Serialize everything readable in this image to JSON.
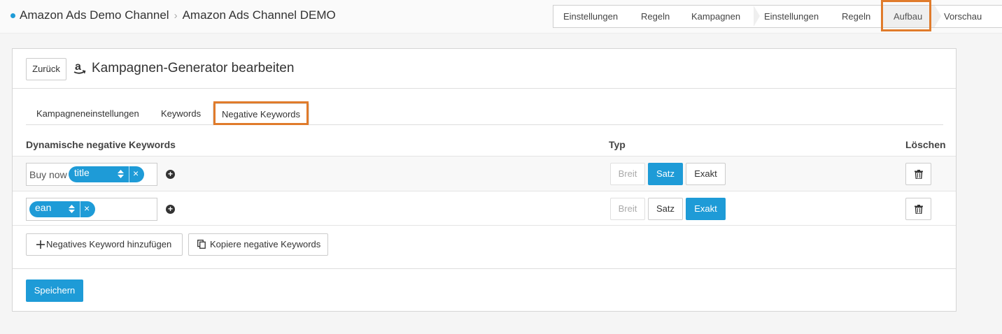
{
  "breadcrumb": {
    "channel": "Amazon Ads Demo Channel",
    "current": "Amazon Ads Channel DEMO"
  },
  "steps": [
    "Einstellungen",
    "Regeln",
    "Kampagnen",
    "Einstellungen",
    "Regeln",
    "Aufbau",
    "Vorschau"
  ],
  "header": {
    "back_label": "Zurück",
    "title": "Kampagnen-Generator bearbeiten"
  },
  "tabs": [
    "Kampagneneinstellungen",
    "Keywords",
    "Negative Keywords"
  ],
  "table": {
    "col_keywords": "Dynamische negative Keywords",
    "col_type": "Typ",
    "col_delete": "Löschen",
    "rows": [
      {
        "text": "Buy now",
        "pill": "title",
        "selected_type": "Satz"
      },
      {
        "text": "",
        "pill": "ean",
        "selected_type": "Exakt"
      }
    ],
    "type_options": [
      "Breit",
      "Satz",
      "Exakt"
    ]
  },
  "actions": {
    "add_label": "Negatives Keyword hinzufügen",
    "copy_label": "Kopiere negative Keywords",
    "save_label": "Speichern"
  },
  "colors": {
    "accent": "#1e9bd7",
    "highlight": "#e07b2b"
  }
}
